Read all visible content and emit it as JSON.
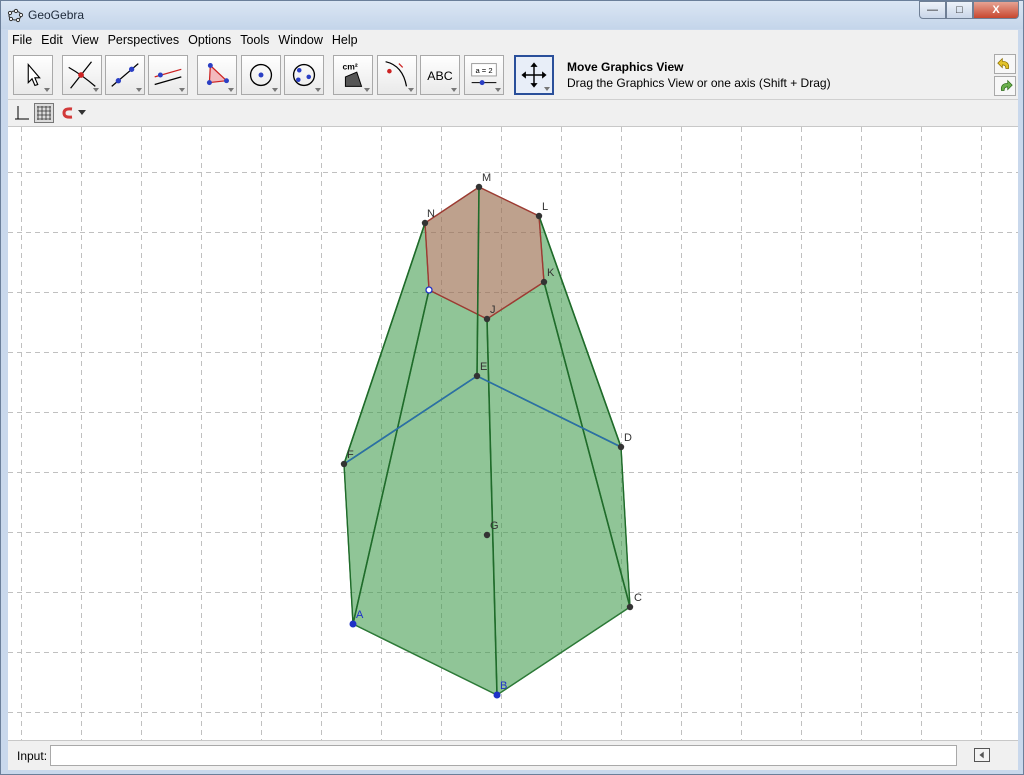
{
  "window": {
    "title": "GeoGebra",
    "controls": {
      "minimize": "—",
      "maximize": "□",
      "close": "X"
    }
  },
  "menu": [
    "File",
    "Edit",
    "View",
    "Perspectives",
    "Options",
    "Tools",
    "Window",
    "Help"
  ],
  "toolbar": {
    "tools": [
      {
        "name": "move-tool",
        "icon": "arrow-cursor-icon"
      },
      {
        "name": "point-tool",
        "icon": "intersect-point-icon"
      },
      {
        "name": "line-tool",
        "icon": "line-through-points-icon"
      },
      {
        "name": "parallel-tool",
        "icon": "parallel-line-icon"
      },
      {
        "name": "polygon-tool",
        "icon": "polygon-icon"
      },
      {
        "name": "circle-tool",
        "icon": "circle-center-icon"
      },
      {
        "name": "conic-tool",
        "icon": "circle-three-points-icon"
      },
      {
        "name": "measure-tool",
        "icon": "area-measure-icon"
      },
      {
        "name": "transform-tool",
        "icon": "reflect-icon"
      },
      {
        "name": "text-tool",
        "icon": "text-abc-icon"
      },
      {
        "name": "slider-tool",
        "icon": "slider-icon"
      },
      {
        "name": "move-graphics-tool",
        "icon": "move-graphics-icon"
      }
    ],
    "measure_label": "cm²",
    "text_label": "ABC",
    "slider_label": "a = 2",
    "active_tool_name": "Move Graphics View",
    "active_tool_desc": "Drag the Graphics View or one axis (Shift + Drag)"
  },
  "colors": {
    "face_green": "#3f9a4a",
    "face_red": "#c0584f",
    "edge_green": "#1f6b2a",
    "free_point": "#1f31c8",
    "dependent_point": "#333333",
    "grid": "#c0c0c0"
  },
  "points": {
    "A": "A",
    "B": "B",
    "C": "C",
    "D": "D",
    "E": "E",
    "F": "F",
    "G": "G",
    "J": "J",
    "K": "K",
    "L": "L",
    "M": "M",
    "N": "N"
  },
  "input": {
    "label": "Input:",
    "value": ""
  }
}
